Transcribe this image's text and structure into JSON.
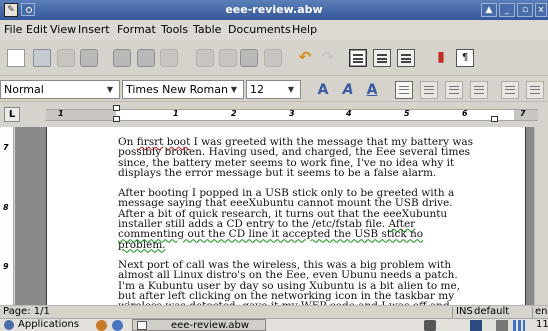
{
  "window": {
    "title": "eee-review.abw"
  },
  "menu": [
    "File",
    "Edit",
    "View",
    "Insert",
    "Format",
    "Tools",
    "Table",
    "Documents",
    "Help"
  ],
  "toolbar": {
    "icons": [
      "new-document",
      "open-folder",
      "save",
      "save-as",
      "print",
      "print-preview",
      "export",
      "cut",
      "copy",
      "paste",
      "format-painter",
      "undo",
      "redo",
      "layout-normal",
      "layout-two-column",
      "layout-table",
      "insert-chart",
      "show-paragraph-marks"
    ]
  },
  "format": {
    "style": "Normal",
    "font": "Times New Roman",
    "size": "12",
    "bold_glyph": "A",
    "italic_glyph": "A",
    "underline_glyph": "A"
  },
  "ruler": {
    "tab_selector": "L",
    "numbers": [
      "1",
      "1",
      "2",
      "3",
      "4",
      "5",
      "6",
      "7"
    ],
    "vertical_numbers": [
      "7",
      "8",
      "9"
    ]
  },
  "document": {
    "paragraphs": [
      {
        "parts": [
          {
            "t": "On "
          },
          {
            "t": "firsrt",
            "s": "red"
          },
          {
            "t": " "
          },
          {
            "t": "boot",
            "s": "red"
          },
          {
            "t": " I was greeted with the message that my battery was possibly broken. Having used, and charged, the Eee several times since, the battery meter seems to work fine, I've no idea why it displays the error message but it seems to be a false alarm."
          }
        ]
      },
      {
        "parts": [
          {
            "t": "After booting I popped in a USB stick only to be greeted with a message saying that eeeXubuntu cannot mount the USB drive. After a bit of quick research, it turns out that the eeeXubuntu installer still adds a CD entry to the /etc/fstab file. "
          },
          {
            "t": "After commenting out the CD line it accepted the USB stick no problem.",
            "s": "green"
          }
        ]
      },
      {
        "parts": [
          {
            "t": "Next port of call was the wireless, this was a big problem with almost all Linux distro's on the Eee, even Ubunu needs a patch. I'm a Kubuntu user by day so using Xubuntu is a bit alien to me, but after left clicking on the networking icon in the taskbar my wireless was detected, gave it my WEP code and I was off and running!"
          }
        ]
      }
    ]
  },
  "status": {
    "page": "Page: 1/1",
    "mode": "INS",
    "style": "default",
    "lang": "en"
  },
  "panel": {
    "applications": "Applications",
    "task": "eee-review.abw",
    "clock": "11"
  },
  "colors": {
    "titlebar": "#34579a",
    "spelling": "#d03030",
    "grammar": "#2a9a2a",
    "accent": "#3a5aa0"
  }
}
